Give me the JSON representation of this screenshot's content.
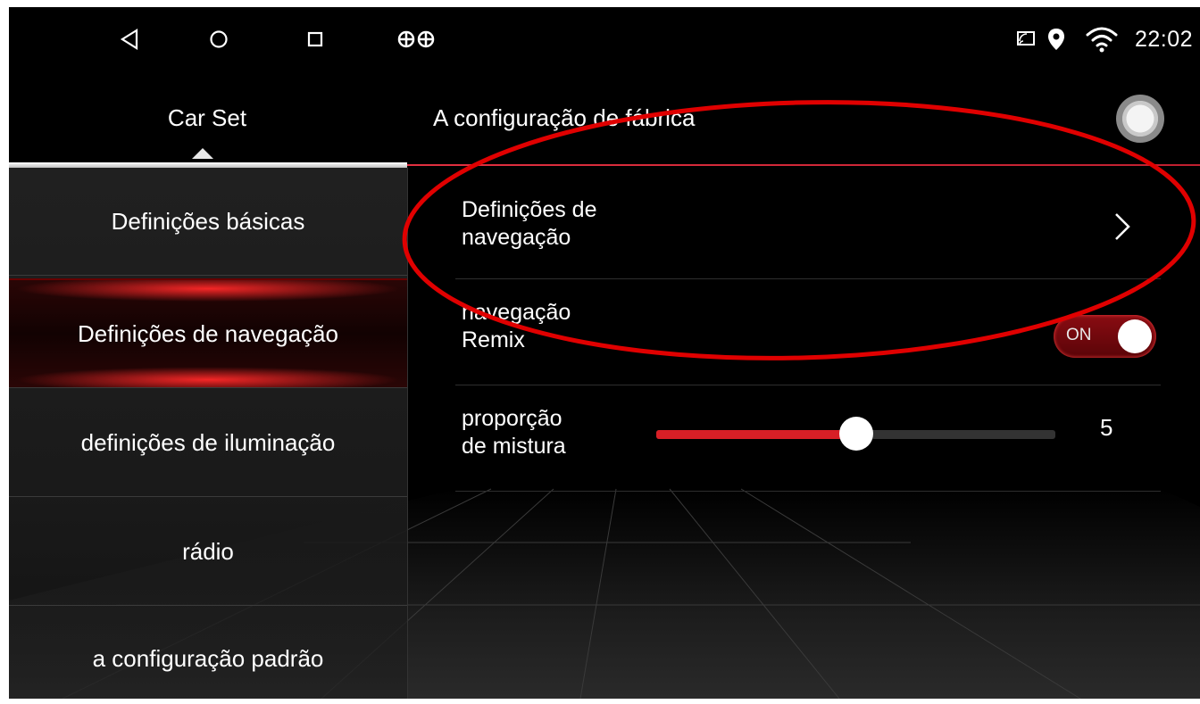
{
  "status_bar": {
    "nav_back_icon": "back-triangle-icon",
    "nav_home_icon": "home-circle-icon",
    "nav_recent_icon": "recent-square-icon",
    "app_icons": "steering-wheel-icon",
    "cast_icon": "cast-icon",
    "location_icon": "location-pin-icon",
    "wifi_icon": "wifi-icon",
    "time": "22:02"
  },
  "header": {
    "tab_label": "Car Set",
    "title": "A configuração de fábrica",
    "power_icon": "power-toggle-icon"
  },
  "sidebar": {
    "items": [
      {
        "label": "Definições básicas",
        "active": false
      },
      {
        "label": "Definições de navegação",
        "active": true
      },
      {
        "label": "definições de iluminação",
        "active": false
      },
      {
        "label": "rádio",
        "active": false
      },
      {
        "label": "a configuração padrão",
        "active": false
      }
    ]
  },
  "content": {
    "nav_settings": {
      "label_line1": "Definições de",
      "label_line2": "navegação"
    },
    "remix": {
      "label_line1": "navegação",
      "label_line2": "Remix",
      "toggle_text": "ON",
      "on": true
    },
    "mix_ratio": {
      "label_line1": "proporção",
      "label_line2": "de mistura",
      "value": "5",
      "fill_fraction": 0.5
    }
  },
  "colors": {
    "accent_red": "#d81f26",
    "annotation_red": "#e00000",
    "background": "#000000"
  }
}
